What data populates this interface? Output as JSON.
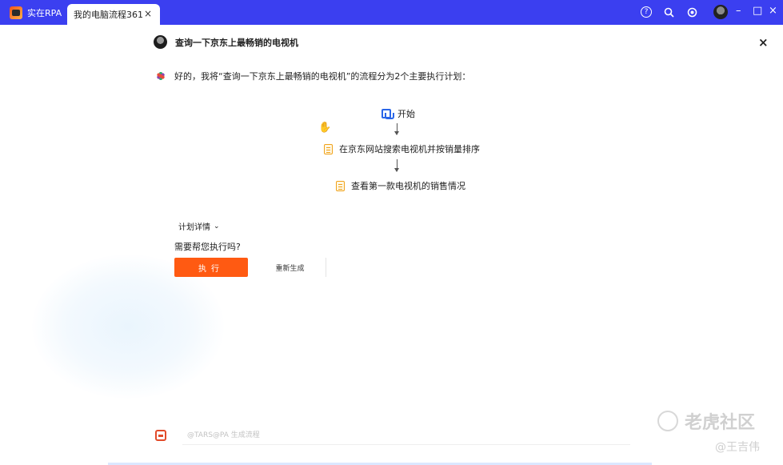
{
  "titlebar": {
    "home_tab": "实在RPA",
    "active_tab": "我的电脑流程361",
    "tab_close": "×",
    "icons": [
      "help-icon",
      "search-icon",
      "settings-icon"
    ],
    "window_buttons": {
      "minimize": "–",
      "maximize": "□",
      "close": "×"
    }
  },
  "main": {
    "close_label": "×"
  },
  "chat": {
    "user_query": "查询一下京东上最畅销的电视机",
    "bot_reply": "好的，我将“查询一下京东上最畅销的电视机”的流程分为2个主要执行计划："
  },
  "flow": {
    "start": "开始",
    "steps": [
      "在京东网站搜索电视机并按销量排序",
      "查看第一款电视机的销售情况"
    ]
  },
  "plan": {
    "detail_label": "计划详情",
    "question": "需要帮您执行吗?"
  },
  "buttons": {
    "execute": "执行",
    "regenerate": "重新生成"
  },
  "input": {
    "placeholder": "@TARS@PA 生成流程"
  },
  "watermark": {
    "brand": "老虎社区",
    "author": "@王吉伟"
  },
  "colors": {
    "titlebar": "#3b3ff0",
    "execute_button": "#ff5a12",
    "start_icon": "#2a66e8",
    "doc_icon": "#f0a21a"
  }
}
